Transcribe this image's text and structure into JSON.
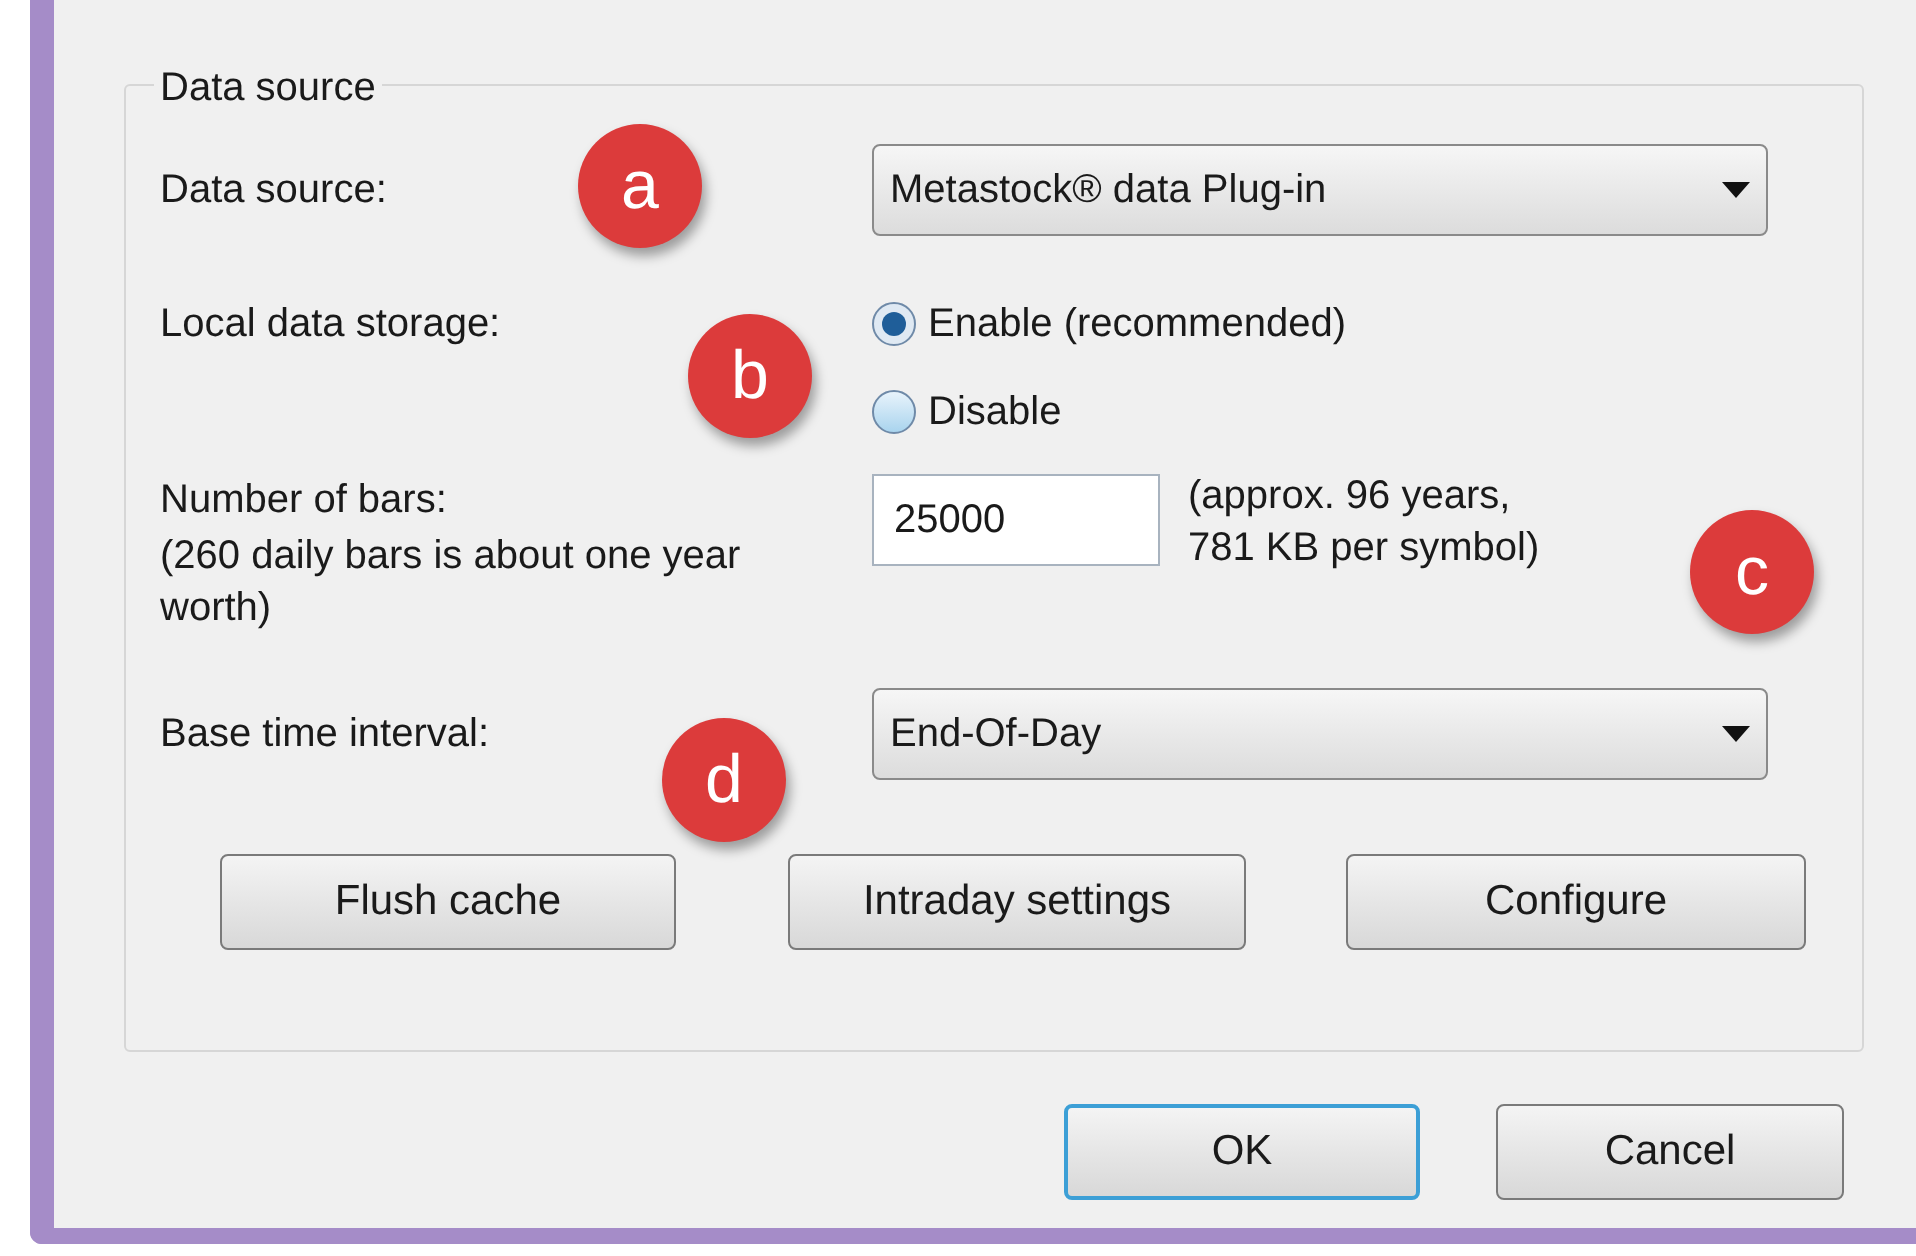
{
  "group": {
    "title": "Data source"
  },
  "data_source": {
    "label": "Data source:",
    "value": "Metastock® data Plug-in"
  },
  "local_storage": {
    "label": "Local data storage:",
    "options": [
      {
        "label": "Enable (recommended)",
        "selected": true
      },
      {
        "label": "Disable",
        "selected": false
      }
    ]
  },
  "bars": {
    "label": "Number of bars:",
    "hint": "(260 daily bars is about one year worth)",
    "value": "25000",
    "estimate": "(approx. 96 years, 781 KB per symbol)"
  },
  "interval": {
    "label": "Base time interval:",
    "value": "End-Of-Day"
  },
  "group_buttons": [
    "Flush cache",
    "Intraday settings",
    "Configure"
  ],
  "dialog_buttons": [
    {
      "label": "OK",
      "default": true
    },
    {
      "label": "Cancel",
      "default": false
    }
  ],
  "callouts": [
    "a",
    "b",
    "c",
    "d"
  ]
}
